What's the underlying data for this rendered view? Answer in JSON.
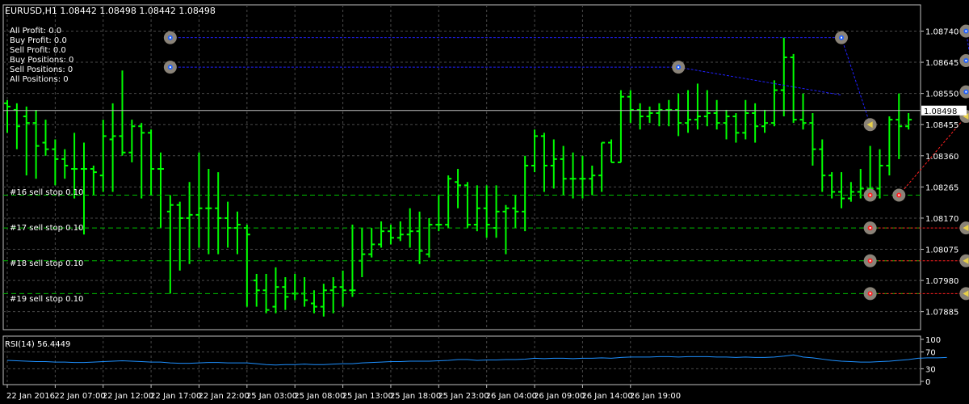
{
  "chart_data": {
    "type": "ohlc",
    "title": "EURUSD,H1  1.08442 1.08498 1.08442 1.08498",
    "current_price": 1.08498,
    "current_price_label": "1.08498",
    "ylim": [
      1.0783,
      1.0882
    ],
    "y_ticks": [
      "1.08740",
      "1.08645",
      "1.08550",
      "1.08455",
      "1.08360",
      "1.08265",
      "1.08170",
      "1.08075",
      "1.07980",
      "1.07885"
    ],
    "x_ticks": [
      "22 Jan 2016",
      "22 Jan 07:00",
      "22 Jan 12:00",
      "22 Jan 17:00",
      "22 Jan 22:00",
      "25 Jan 03:00",
      "25 Jan 08:00",
      "25 Jan 13:00",
      "25 Jan 18:00",
      "25 Jan 23:00",
      "26 Jan 04:00",
      "26 Jan 09:00",
      "26 Jan 14:00",
      "26 Jan 19:00"
    ],
    "grid": true,
    "colors": {
      "background": "#000000",
      "bar": "#00ff00",
      "grid": "#4a4a4a",
      "text": "#ffffff",
      "buy_line": "#2020ff",
      "sell_line": "#ff2020",
      "order_line": "#00c000",
      "rsi_line": "#1e90ff"
    },
    "bars": [
      {
        "o": 1.0852,
        "h": 1.0853,
        "l": 1.0843,
        "c": 1.0851
      },
      {
        "o": 1.085,
        "h": 1.0852,
        "l": 1.0838,
        "c": 1.0845
      },
      {
        "o": 1.0848,
        "h": 1.0851,
        "l": 1.083,
        "c": 1.0846
      },
      {
        "o": 1.0846,
        "h": 1.085,
        "l": 1.0829,
        "c": 1.0839
      },
      {
        "o": 1.084,
        "h": 1.0847,
        "l": 1.0836,
        "c": 1.0838
      },
      {
        "o": 1.0838,
        "h": 1.0841,
        "l": 1.0827,
        "c": 1.0835
      },
      {
        "o": 1.0835,
        "h": 1.0838,
        "l": 1.0829,
        "c": 1.0833
      },
      {
        "o": 1.0832,
        "h": 1.0843,
        "l": 1.0823,
        "c": 1.0832
      },
      {
        "o": 1.0832,
        "h": 1.084,
        "l": 1.0812,
        "c": 1.0832
      },
      {
        "o": 1.0832,
        "h": 1.0833,
        "l": 1.0824,
        "c": 1.0831
      },
      {
        "o": 1.083,
        "h": 1.0847,
        "l": 1.0825,
        "c": 1.0842
      },
      {
        "o": 1.0841,
        "h": 1.0852,
        "l": 1.0825,
        "c": 1.0842
      },
      {
        "o": 1.0842,
        "h": 1.0862,
        "l": 1.0836,
        "c": 1.0837
      },
      {
        "o": 1.0837,
        "h": 1.0847,
        "l": 1.0834,
        "c": 1.0845
      },
      {
        "o": 1.0845,
        "h": 1.0846,
        "l": 1.0823,
        "c": 1.0843
      },
      {
        "o": 1.0843,
        "h": 1.0844,
        "l": 1.0824,
        "c": 1.0832
      },
      {
        "o": 1.0832,
        "h": 1.0837,
        "l": 1.0814,
        "c": 1.0832
      },
      {
        "o": 1.0819,
        "h": 1.0824,
        "l": 1.0794,
        "c": 1.0821
      },
      {
        "o": 1.0821,
        "h": 1.0822,
        "l": 1.0801,
        "c": 1.0817
      },
      {
        "o": 1.0817,
        "h": 1.0828,
        "l": 1.0803,
        "c": 1.0818
      },
      {
        "o": 1.0818,
        "h": 1.0837,
        "l": 1.0808,
        "c": 1.082
      },
      {
        "o": 1.082,
        "h": 1.0832,
        "l": 1.0806,
        "c": 1.082
      },
      {
        "o": 1.082,
        "h": 1.0831,
        "l": 1.0806,
        "c": 1.0817
      },
      {
        "o": 1.0817,
        "h": 1.0822,
        "l": 1.0808,
        "c": 1.0814
      },
      {
        "o": 1.0814,
        "h": 1.0819,
        "l": 1.0806,
        "c": 1.0815
      },
      {
        "o": 1.0814,
        "h": 1.0815,
        "l": 1.079,
        "c": 1.0812
      },
      {
        "o": 1.0798,
        "h": 1.08,
        "l": 1.079,
        "c": 1.0795
      },
      {
        "o": 1.0795,
        "h": 1.08,
        "l": 1.0788,
        "c": 1.0789
      },
      {
        "o": 1.079,
        "h": 1.0802,
        "l": 1.0788,
        "c": 1.0796
      },
      {
        "o": 1.0796,
        "h": 1.0799,
        "l": 1.0789,
        "c": 1.0793
      },
      {
        "o": 1.0794,
        "h": 1.08,
        "l": 1.0792,
        "c": 1.0794
      },
      {
        "o": 1.0794,
        "h": 1.0799,
        "l": 1.079,
        "c": 1.0792
      },
      {
        "o": 1.0791,
        "h": 1.0795,
        "l": 1.0788,
        "c": 1.079
      },
      {
        "o": 1.079,
        "h": 1.0797,
        "l": 1.0787,
        "c": 1.0795
      },
      {
        "o": 1.0795,
        "h": 1.0799,
        "l": 1.0788,
        "c": 1.0796
      },
      {
        "o": 1.0796,
        "h": 1.0801,
        "l": 1.079,
        "c": 1.0795
      },
      {
        "o": 1.0795,
        "h": 1.0815,
        "l": 1.0793,
        "c": 1.0795
      },
      {
        "o": 1.0804,
        "h": 1.0814,
        "l": 1.0799,
        "c": 1.0806
      },
      {
        "o": 1.0806,
        "h": 1.0814,
        "l": 1.0805,
        "c": 1.0809
      },
      {
        "o": 1.0809,
        "h": 1.0816,
        "l": 1.0808,
        "c": 1.0813
      },
      {
        "o": 1.0813,
        "h": 1.0815,
        "l": 1.0809,
        "c": 1.0811
      },
      {
        "o": 1.0811,
        "h": 1.0816,
        "l": 1.081,
        "c": 1.0812
      },
      {
        "o": 1.0812,
        "h": 1.082,
        "l": 1.0808,
        "c": 1.0813
      },
      {
        "o": 1.0813,
        "h": 1.0819,
        "l": 1.0803,
        "c": 1.0807
      },
      {
        "o": 1.0806,
        "h": 1.0817,
        "l": 1.0805,
        "c": 1.0815
      },
      {
        "o": 1.0815,
        "h": 1.0824,
        "l": 1.0813,
        "c": 1.0815
      },
      {
        "o": 1.0815,
        "h": 1.083,
        "l": 1.0814,
        "c": 1.0829
      },
      {
        "o": 1.0828,
        "h": 1.0832,
        "l": 1.082,
        "c": 1.0827
      },
      {
        "o": 1.0827,
        "h": 1.0828,
        "l": 1.0814,
        "c": 1.0815
      },
      {
        "o": 1.0815,
        "h": 1.0827,
        "l": 1.0813,
        "c": 1.082
      },
      {
        "o": 1.082,
        "h": 1.0827,
        "l": 1.0811,
        "c": 1.0815
      },
      {
        "o": 1.0814,
        "h": 1.0827,
        "l": 1.0811,
        "c": 1.0819
      },
      {
        "o": 1.0819,
        "h": 1.0821,
        "l": 1.0806,
        "c": 1.082
      },
      {
        "o": 1.082,
        "h": 1.0824,
        "l": 1.0814,
        "c": 1.0819
      },
      {
        "o": 1.0819,
        "h": 1.0836,
        "l": 1.0813,
        "c": 1.0833
      },
      {
        "o": 1.0833,
        "h": 1.0844,
        "l": 1.0831,
        "c": 1.0842
      },
      {
        "o": 1.0842,
        "h": 1.0843,
        "l": 1.0825,
        "c": 1.0833
      },
      {
        "o": 1.0833,
        "h": 1.0841,
        "l": 1.0826,
        "c": 1.0835
      },
      {
        "o": 1.0835,
        "h": 1.0839,
        "l": 1.0824,
        "c": 1.0829
      },
      {
        "o": 1.0829,
        "h": 1.0837,
        "l": 1.0823,
        "c": 1.0829
      },
      {
        "o": 1.0829,
        "h": 1.0836,
        "l": 1.0823,
        "c": 1.0829
      },
      {
        "o": 1.0829,
        "h": 1.0833,
        "l": 1.0824,
        "c": 1.083
      },
      {
        "o": 1.083,
        "h": 1.084,
        "l": 1.0825,
        "c": 1.084
      },
      {
        "o": 1.084,
        "h": 1.0841,
        "l": 1.0834,
        "c": 1.0834
      },
      {
        "o": 1.0834,
        "h": 1.0856,
        "l": 1.0834,
        "c": 1.0854
      },
      {
        "o": 1.0854,
        "h": 1.0856,
        "l": 1.0846,
        "c": 1.085
      },
      {
        "o": 1.085,
        "h": 1.0852,
        "l": 1.0844,
        "c": 1.0848
      },
      {
        "o": 1.0848,
        "h": 1.0851,
        "l": 1.0846,
        "c": 1.0849
      },
      {
        "o": 1.0849,
        "h": 1.0852,
        "l": 1.0845,
        "c": 1.085
      },
      {
        "o": 1.085,
        "h": 1.0853,
        "l": 1.0845,
        "c": 1.085
      },
      {
        "o": 1.085,
        "h": 1.0855,
        "l": 1.0842,
        "c": 1.0846
      },
      {
        "o": 1.0846,
        "h": 1.0856,
        "l": 1.0843,
        "c": 1.0847
      },
      {
        "o": 1.0847,
        "h": 1.0858,
        "l": 1.0844,
        "c": 1.0848
      },
      {
        "o": 1.0848,
        "h": 1.0856,
        "l": 1.0845,
        "c": 1.0849
      },
      {
        "o": 1.0849,
        "h": 1.0853,
        "l": 1.0844,
        "c": 1.0846
      },
      {
        "o": 1.0846,
        "h": 1.085,
        "l": 1.0841,
        "c": 1.0848
      },
      {
        "o": 1.0848,
        "h": 1.0849,
        "l": 1.084,
        "c": 1.0843
      },
      {
        "o": 1.0843,
        "h": 1.0853,
        "l": 1.0841,
        "c": 1.0849
      },
      {
        "o": 1.0849,
        "h": 1.0852,
        "l": 1.084,
        "c": 1.0845
      },
      {
        "o": 1.0845,
        "h": 1.085,
        "l": 1.0843,
        "c": 1.0846
      },
      {
        "o": 1.0846,
        "h": 1.0859,
        "l": 1.0845,
        "c": 1.0856
      },
      {
        "o": 1.0856,
        "h": 1.0872,
        "l": 1.0848,
        "c": 1.0866
      },
      {
        "o": 1.0866,
        "h": 1.0867,
        "l": 1.0846,
        "c": 1.0847
      },
      {
        "o": 1.0847,
        "h": 1.0855,
        "l": 1.0844,
        "c": 1.0846
      },
      {
        "o": 1.0846,
        "h": 1.0849,
        "l": 1.0833,
        "c": 1.0838
      },
      {
        "o": 1.0838,
        "h": 1.0841,
        "l": 1.0825,
        "c": 1.083
      },
      {
        "o": 1.083,
        "h": 1.0831,
        "l": 1.0823,
        "c": 1.0825
      },
      {
        "o": 1.0825,
        "h": 1.0831,
        "l": 1.082,
        "c": 1.0823
      },
      {
        "o": 1.0823,
        "h": 1.0828,
        "l": 1.0822,
        "c": 1.0825
      },
      {
        "o": 1.0825,
        "h": 1.0832,
        "l": 1.0823,
        "c": 1.0826
      },
      {
        "o": 1.0826,
        "h": 1.0839,
        "l": 1.0824,
        "c": 1.0826
      },
      {
        "o": 1.0826,
        "h": 1.0838,
        "l": 1.0823,
        "c": 1.0833
      },
      {
        "o": 1.0833,
        "h": 1.0848,
        "l": 1.083,
        "c": 1.0847
      },
      {
        "o": 1.0847,
        "h": 1.0855,
        "l": 1.0835,
        "c": 1.0845
      },
      {
        "o": 1.0845,
        "h": 1.0849,
        "l": 1.0844,
        "c": 1.0847
      }
    ],
    "account_info": [
      "All Profit: 0.0",
      "Buy Profit:  0.0",
      "Sell Profit: 0.0",
      "Buy Positions:  0",
      "Sell Positions: 0",
      "All Positions: 0"
    ],
    "orders": [
      {
        "label": "#16 sell stop 0.10",
        "price": 1.0824
      },
      {
        "label": "#17 sell stop 0.10",
        "price": 1.0814
      },
      {
        "label": "#18 sell stop 0.10",
        "price": 1.0804
      },
      {
        "label": "#19 sell stop 0.10",
        "price": 1.0794
      }
    ],
    "trade_lines": [
      {
        "side": "buy",
        "points": [
          [
            17,
            1.0872
          ],
          [
            87,
            1.0872
          ]
        ]
      },
      {
        "side": "buy",
        "points": [
          [
            17,
            1.0863
          ],
          [
            70,
            1.0863
          ],
          [
            87,
            1.08545
          ]
        ]
      },
      {
        "side": "buy",
        "points": [
          [
            87,
            1.0872
          ],
          [
            90,
            1.08455
          ]
        ]
      },
      {
        "side": "buy",
        "points": [
          [
            100,
            1.0874
          ],
          [
            101,
            1.0855
          ]
        ]
      },
      {
        "side": "buy",
        "points": [
          [
            100,
            1.0865
          ],
          [
            101,
            1.0865
          ],
          [
            103,
            1.08455
          ]
        ]
      },
      {
        "side": "sell",
        "points": [
          [
            93,
            1.0824
          ],
          [
            100,
            1.0848
          ]
        ]
      },
      {
        "side": "sell",
        "points": [
          [
            90,
            1.0814
          ],
          [
            100,
            1.0814
          ]
        ]
      },
      {
        "side": "sell",
        "points": [
          [
            90,
            1.0804
          ],
          [
            100,
            1.0804
          ]
        ]
      },
      {
        "side": "sell",
        "points": [
          [
            90,
            1.0794
          ],
          [
            100,
            1.0794
          ]
        ]
      }
    ],
    "markers": [
      {
        "x": 17,
        "price": 1.0872,
        "kind": "buy"
      },
      {
        "x": 17,
        "price": 1.0863,
        "kind": "buy"
      },
      {
        "x": 70,
        "price": 1.0863,
        "kind": "buy"
      },
      {
        "x": 87,
        "price": 1.0872,
        "kind": "buy"
      },
      {
        "x": 100,
        "price": 1.0874,
        "kind": "buy"
      },
      {
        "x": 103,
        "price": 1.0874,
        "kind": "close"
      },
      {
        "x": 100,
        "price": 1.0865,
        "kind": "buy"
      },
      {
        "x": 101,
        "price": 1.0865,
        "kind": "buy"
      },
      {
        "x": 100,
        "price": 1.08555,
        "kind": "buy"
      },
      {
        "x": 90,
        "price": 1.08455,
        "kind": "close"
      },
      {
        "x": 100,
        "price": 1.0848,
        "kind": "close"
      },
      {
        "x": 103,
        "price": 1.0845,
        "kind": "close"
      },
      {
        "x": 90,
        "price": 1.0824,
        "kind": "sell"
      },
      {
        "x": 93,
        "price": 1.0824,
        "kind": "sell"
      },
      {
        "x": 103,
        "price": 1.0824,
        "kind": "sell"
      },
      {
        "x": 90,
        "price": 1.0814,
        "kind": "sell"
      },
      {
        "x": 100,
        "price": 1.0814,
        "kind": "close"
      },
      {
        "x": 103,
        "price": 1.0814,
        "kind": "sell"
      },
      {
        "x": 90,
        "price": 1.0804,
        "kind": "sell"
      },
      {
        "x": 100,
        "price": 1.0804,
        "kind": "close"
      },
      {
        "x": 103,
        "price": 1.0804,
        "kind": "sell"
      },
      {
        "x": 90,
        "price": 1.0794,
        "kind": "sell"
      },
      {
        "x": 100,
        "price": 1.0794,
        "kind": "close"
      },
      {
        "x": 103,
        "price": 1.0794,
        "kind": "sell"
      }
    ],
    "rsi": {
      "label": "RSI(14) 56.4449",
      "ylim": [
        0,
        100
      ],
      "ticks": [
        "100",
        "70",
        "30",
        "0"
      ],
      "levels": [
        70,
        30
      ],
      "values": [
        50,
        49,
        48,
        47,
        47,
        46,
        46,
        45,
        45,
        46,
        47,
        48,
        49,
        48,
        47,
        46,
        46,
        44,
        43,
        43,
        44,
        45,
        45,
        44,
        44,
        44,
        42,
        40,
        39,
        40,
        40,
        41,
        40,
        40,
        41,
        42,
        42,
        44,
        45,
        46,
        47,
        47,
        48,
        48,
        48,
        49,
        50,
        52,
        52,
        50,
        51,
        51,
        52,
        52,
        53,
        55,
        54,
        55,
        55,
        54,
        55,
        55,
        56,
        55,
        57,
        58,
        58,
        58,
        59,
        59,
        58,
        59,
        59,
        59,
        58,
        58,
        57,
        58,
        57,
        57,
        58,
        60,
        63,
        58,
        56,
        53,
        50,
        48,
        47,
        46,
        46,
        47,
        48,
        50,
        52,
        55,
        56,
        56,
        57
      ]
    }
  }
}
